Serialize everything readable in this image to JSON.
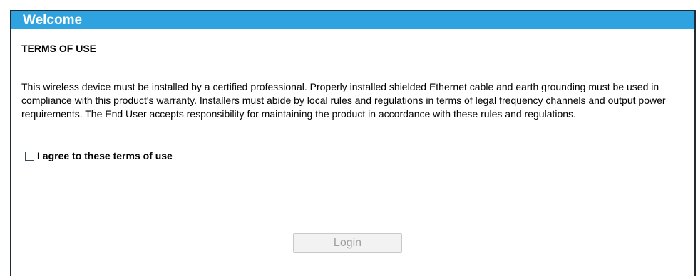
{
  "header": {
    "title": "Welcome"
  },
  "terms": {
    "heading": "TERMS OF USE",
    "body": "This wireless device must be installed by a certified professional. Properly installed shielded Ethernet cable and earth grounding must be used in compliance with this product's warranty. Installers must abide by local rules and regulations in terms of legal frequency channels and output power requirements. The End User accepts responsibility for maintaining the product in accordance with these rules and regulations."
  },
  "agreement": {
    "label": "I agree to these terms of use",
    "checked": false
  },
  "actions": {
    "login_label": "Login",
    "login_enabled": false
  },
  "colors": {
    "header_background": "#2ea3e0",
    "header_text": "#ffffff",
    "disabled_text": "#a0a0a0"
  }
}
